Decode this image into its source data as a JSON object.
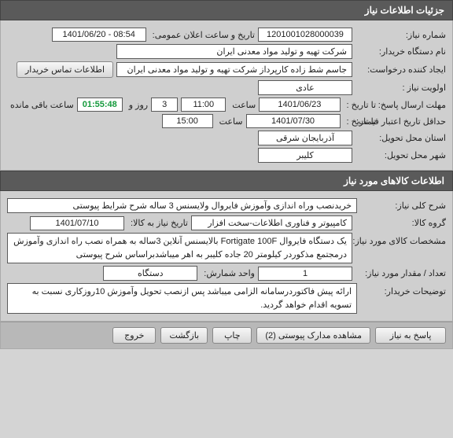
{
  "section1": {
    "title": "جزئیات اطلاعات نیاز"
  },
  "req": {
    "number_label": "شماره نیاز:",
    "number": "1201001028000039",
    "announce_label": "تاریخ و ساعت اعلان عمومی:",
    "announce": "1401/06/20 - 08:54",
    "buyer_label": "نام دستگاه خریدار:",
    "buyer": "شرکت تهیه و تولید مواد معدنی ایران",
    "requester_label": "ایجاد کننده درخواست:",
    "requester": "جاسم شط زاده کارپرداز شرکت تهیه و تولید مواد معدنی ایران",
    "contact_btn": "اطلاعات تماس خریدار",
    "priority_label": "اولویت نیاز :",
    "priority": "عادی",
    "deadline_label": "مهلت ارسال پاسخ:",
    "to_date_label": "تا تاریخ :",
    "deadline_date": "1401/06/23",
    "time_label": "ساعت",
    "deadline_time": "11:00",
    "days_unit": "روز و",
    "days": "3",
    "countdown": "01:55:48",
    "remain_label": "ساعت باقی مانده",
    "validity_label": "حداقل تاریخ اعتبار قیمت:",
    "validity_date": "1401/07/30",
    "validity_time": "15:00",
    "province_label": "استان محل تحویل:",
    "province": "آذربایجان شرقی",
    "city_label": "شهر محل تحویل:",
    "city": "کلیبر"
  },
  "section2": {
    "title": "اطلاعات کالاهای مورد نیاز"
  },
  "goods": {
    "desc_label": "شرح کلی نیاز:",
    "desc": "خریدنصب وراه اندازی وآموزش فایروال ولایسنس 3 ساله شرح شرایط پیوستی",
    "group_label": "گروه کالا:",
    "group": "کامپیوتر و فناوری اطلاعات-سخت افزار",
    "need_date_label": "تاریخ نیاز به کالا:",
    "need_date": "1401/07/10",
    "spec_label": "مشخصات کالای مورد نیاز:",
    "spec": "یک دستگاه فایروال Fortigate 100F بالایسنس آنلاین 3ساله به همراه نصب راه اندازی وآموزش درمجتمع مذکوردر کیلومتر 20 جاده  کلیبر به اهر میباشدبراساس شرح پیوستی",
    "qty_label": "تعداد / مقدار مورد نیاز:",
    "qty": "1",
    "unit_label": "واحد شمارش:",
    "unit": "دستگاه",
    "notes_label": "توضیحات خریدار:",
    "notes": "ارائه پیش فاکتوردرسامانه الزامی میباشد پس ازنصب تحویل وآموزش 10روزکاری نسبت به تسویه اقدام خواهد گردید."
  },
  "footer": {
    "respond": "پاسخ به نیاز",
    "attachments": "مشاهده مدارک پیوستی (2)",
    "print": "چاپ",
    "back": "بازگشت",
    "exit": "خروج"
  }
}
